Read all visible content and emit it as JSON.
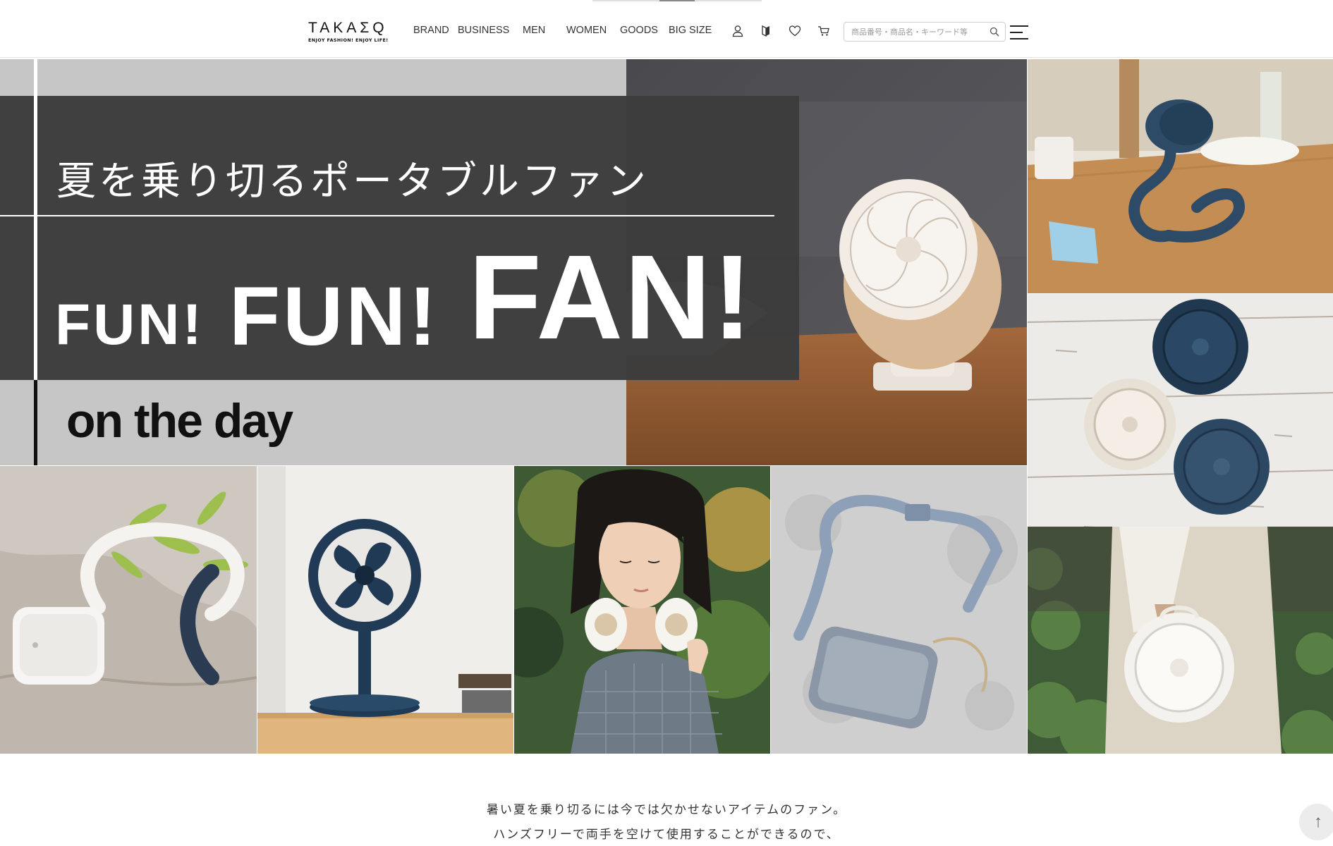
{
  "header": {
    "logo": {
      "wordmark": "TAKAΣQ",
      "tagline": "ENJOY FASHION! ENJOY LIFE!"
    },
    "nav": [
      {
        "key": "brand",
        "label": "BRAND"
      },
      {
        "key": "business",
        "label": "BUSINESS"
      },
      {
        "key": "men",
        "label": "MEN"
      },
      {
        "key": "women",
        "label": "WOMEN"
      },
      {
        "key": "goods",
        "label": "GOODS"
      },
      {
        "key": "bigsize",
        "label": "BIG SIZE"
      }
    ],
    "icons": [
      "user-icon",
      "beginner-mark-icon",
      "heart-icon",
      "cart-icon",
      "search-icon",
      "hamburger-menu-icon"
    ],
    "search": {
      "placeholder": "商品番号・商品名・キーワード等",
      "value": ""
    }
  },
  "hero": {
    "subtitle": "夏を乗り切るポータブルファン",
    "headline": [
      "FUN!",
      "FUN!",
      "FAN!"
    ],
    "tagline": "on the day",
    "photos": [
      "clip-fan-on-table",
      "flexible-neck-fan-on-table",
      "three-mini-fans-on-wood",
      "neck-fan-with-greenery",
      "desk-fan-navy",
      "woman-wearing-neck-fan",
      "strap-pouch-fan",
      "white-handheld-fan"
    ]
  },
  "intro": {
    "lines": [
      "暑い夏を乗り切るには今では欠かせないアイテムのファン。",
      "ハンズフリーで両手を空けて使用することができるので、"
    ]
  },
  "pagetop": {
    "label": "↑"
  },
  "colors": {
    "dark_panel": "#3c3c3c",
    "gray_panel": "#c6c6c6",
    "text": "#222222",
    "navy_fan": "#1f3a55"
  }
}
